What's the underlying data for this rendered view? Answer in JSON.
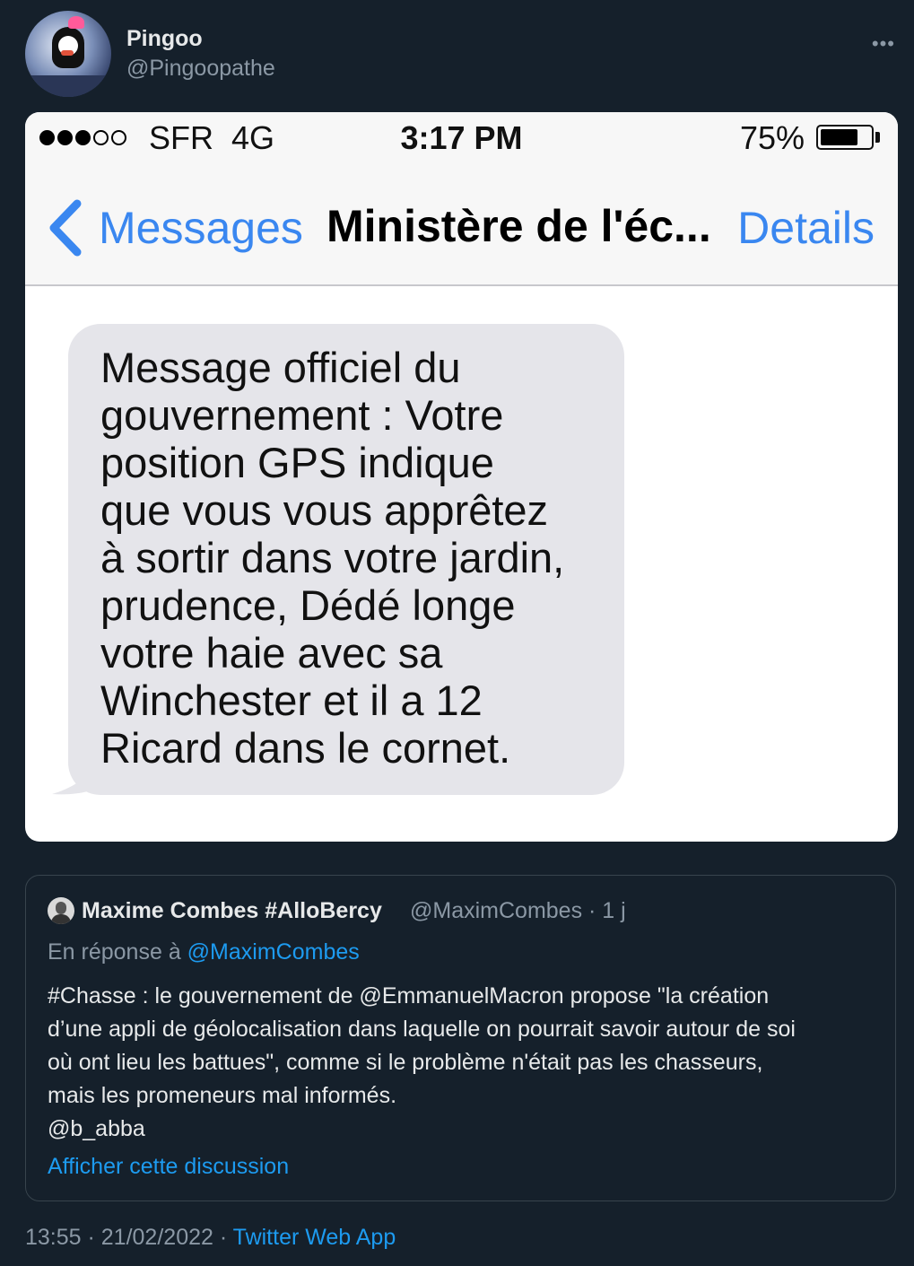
{
  "tweet": {
    "author_name": "Pingoo",
    "author_handle": "@Pingoopathe",
    "more_icon": "more-options-icon",
    "timestamp": "13:55 · 21/02/2022 ·",
    "source_app": "Twitter Web App"
  },
  "screenshot": {
    "carrier": "SFR  4G",
    "time": "3:17 PM",
    "battery": "75%",
    "battery_level": 0.75,
    "back_label": "Messages",
    "conversation_title": "Ministère de l'éc...",
    "details_label": "Details",
    "message": "Message officiel du\ngouvernement : Votre\nposition GPS indique\nque vous vous apprêtez\nà sortir dans votre jardin,\nprudence, Dédé longe\nvotre haie avec sa\nWinchester et il a 12\nRicard dans le cornet."
  },
  "quoted_tweet": {
    "author_name": "Maxime Combes #AlloBercy",
    "author_handle": "@MaximCombes · 1 j",
    "reply_prefix": "En réponse à",
    "reply_to": "@MaximCombes",
    "text": "#Chasse : le gouvernement de @EmmanuelMacron propose \"la création\nd’une appli de géolocalisation dans laquelle on pourrait savoir autour de soi\noù ont lieu les battues\", comme si le problème n'était pas les chasseurs,\nmais les promeneurs mal informés.\n@b_abba",
    "show_thread": "Afficher cette discussion"
  }
}
